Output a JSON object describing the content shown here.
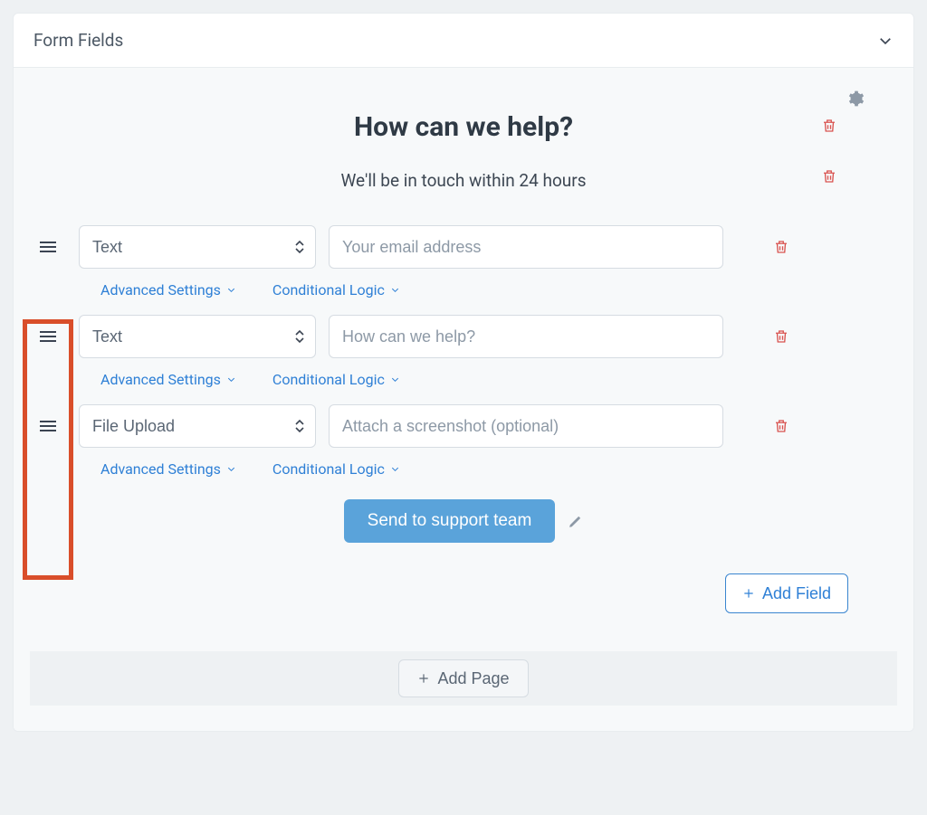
{
  "panel": {
    "title": "Form Fields"
  },
  "form": {
    "heading": "How can we help?",
    "subheading": "We'll be in touch within 24 hours",
    "submit_label": "Send to support team"
  },
  "fields": [
    {
      "type_label": "Text",
      "placeholder": "Your email address"
    },
    {
      "type_label": "Text",
      "placeholder": "How can we help?"
    },
    {
      "type_label": "File Upload",
      "placeholder": "Attach a screenshot (optional)"
    }
  ],
  "links": {
    "advanced": "Advanced Settings",
    "conditional": "Conditional Logic"
  },
  "buttons": {
    "add_field": "Add Field",
    "add_page": "Add Page"
  }
}
